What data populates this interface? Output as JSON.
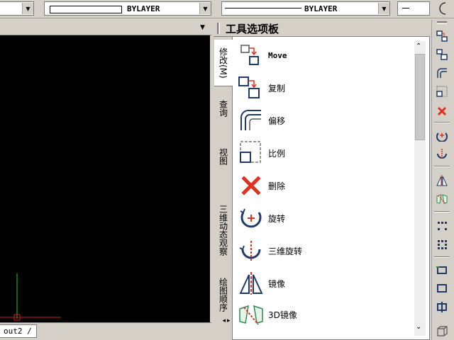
{
  "toolbar": {
    "linetype_value": "BYLAYER",
    "lineweight_value": "BYLAYER",
    "dropdown_glyph": "▾"
  },
  "drawing": {
    "background": "#000000",
    "layout_tab": "out2"
  },
  "palette": {
    "title": "工具选项板",
    "tabs": [
      "修改(M)",
      "查询",
      "视图",
      "三维动态观察",
      "绘图顺序"
    ],
    "tools": [
      {
        "label": "Move",
        "icon": "move-icon"
      },
      {
        "label": "复制",
        "icon": "copy-icon"
      },
      {
        "label": "偏移",
        "icon": "offset-icon"
      },
      {
        "label": "比例",
        "icon": "scale-icon"
      },
      {
        "label": "删除",
        "icon": "erase-icon"
      },
      {
        "label": "旋转",
        "icon": "rotate-icon"
      },
      {
        "label": "三维旋转",
        "icon": "rotate-3d-icon"
      },
      {
        "label": "镜像",
        "icon": "mirror-icon"
      },
      {
        "label": "3D镜像",
        "icon": "mirror-3d-icon"
      }
    ]
  },
  "right_toolbar": [
    "copy-icon",
    "copy-icon",
    "offset-icon",
    "scale-icon",
    "erase-icon",
    "rotate-icon",
    "rotate-3d-icon",
    "mirror-icon",
    "mirror-3d-icon",
    "array-icon",
    "array-path-icon",
    "rectangle-icon",
    "rectangle-icon",
    "center-icon",
    "box-icon"
  ],
  "colors": {
    "accent_red": "#e0301e",
    "icon_navy": "#1f3a6b",
    "toolbar_bg": "#d4d0c8"
  }
}
